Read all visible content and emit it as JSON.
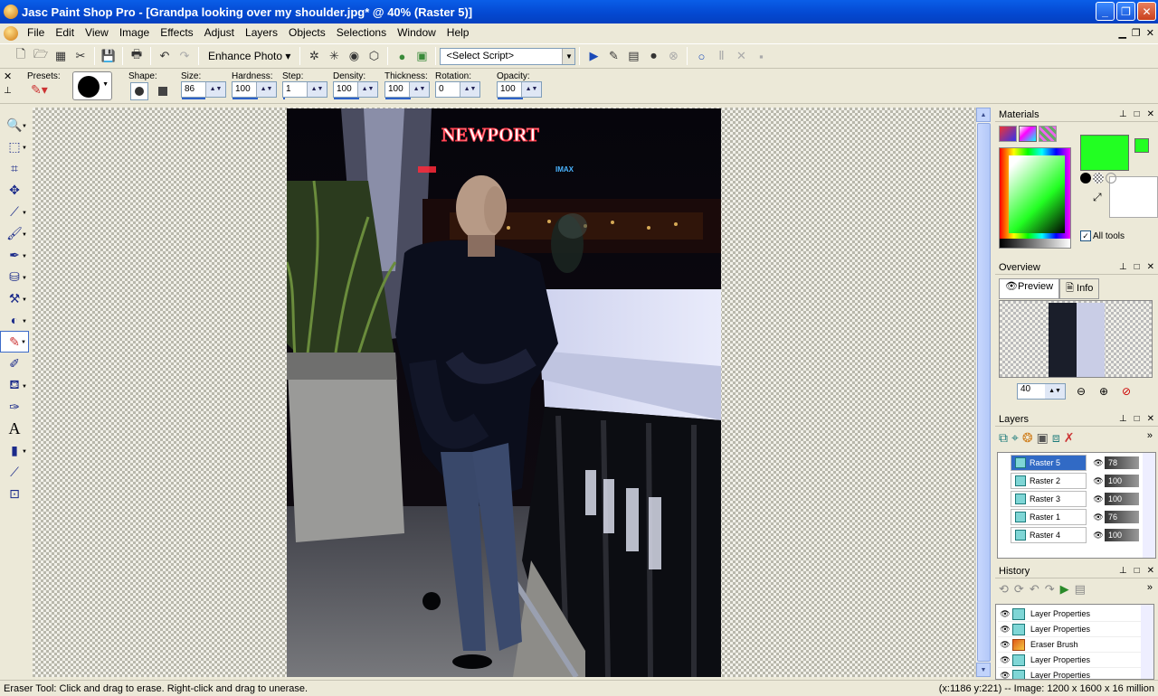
{
  "window": {
    "title": "Jasc Paint Shop Pro - [Grandpa looking over my shoulder.jpg* @  40% (Raster 5)]"
  },
  "menu": [
    "File",
    "Edit",
    "View",
    "Image",
    "Effects",
    "Adjust",
    "Layers",
    "Objects",
    "Selections",
    "Window",
    "Help"
  ],
  "toolbar": {
    "enhance_label": "Enhance Photo",
    "script_select": "<Select Script>"
  },
  "tool_options": {
    "presets_label": "Presets:",
    "shape_label": "Shape:",
    "size_label": "Size:",
    "size": "86",
    "hardness_label": "Hardness:",
    "hardness": "100",
    "step_label": "Step:",
    "step": "1",
    "density_label": "Density:",
    "density": "100",
    "thickness_label": "Thickness:",
    "thickness": "100",
    "rotation_label": "Rotation:",
    "rotation": "0",
    "opacity_label": "Opacity:",
    "opacity": "100"
  },
  "photo": {
    "sign_text": "NEWPORT",
    "imax_text": "IMAX"
  },
  "materials": {
    "title": "Materials",
    "all_tools_label": "All tools",
    "foreground_color": "#22ff22",
    "background_color": "#ffffff"
  },
  "overview": {
    "title": "Overview",
    "tab_preview": "Preview",
    "tab_info": "Info",
    "zoom": "40"
  },
  "layers": {
    "title": "Layers",
    "items": [
      {
        "name": "Raster 5",
        "opacity": "78"
      },
      {
        "name": "Raster 2",
        "opacity": "100"
      },
      {
        "name": "Raster 3",
        "opacity": "100"
      },
      {
        "name": "Raster 1",
        "opacity": "76"
      },
      {
        "name": "Raster 4",
        "opacity": "100"
      }
    ]
  },
  "history": {
    "title": "History",
    "items": [
      "Layer Properties",
      "Layer Properties",
      "Eraser Brush",
      "Layer Properties",
      "Layer Properties"
    ]
  },
  "status": {
    "left": "Eraser Tool: Click and drag to erase. Right-click and drag to unerase.",
    "right": "(x:1186 y:221) -- Image:  1200 x 1600 x 16 million"
  }
}
